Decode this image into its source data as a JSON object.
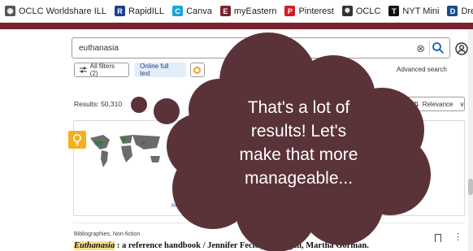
{
  "bookmarks": [
    {
      "label": "OCLC Worldshare ILL",
      "icon": "globe-icon",
      "color": "#555555",
      "glyph": "◉"
    },
    {
      "label": "RapidILL",
      "icon": "rapidill-icon",
      "color": "#1c3f94",
      "glyph": "R"
    },
    {
      "label": "Canva",
      "icon": "canva-icon",
      "color": "#1aa3d9",
      "glyph": "C"
    },
    {
      "label": "myEastern",
      "icon": "eastern-icon",
      "color": "#7a2230",
      "glyph": "E"
    },
    {
      "label": "Pinterest",
      "icon": "pinterest-icon",
      "color": "#cb1f27",
      "glyph": "P"
    },
    {
      "label": "OCLC",
      "icon": "oclc-icon",
      "color": "#333333",
      "glyph": "✸"
    },
    {
      "label": "NYT Mini",
      "icon": "nyt-icon",
      "color": "#111111",
      "glyph": "T"
    },
    {
      "label": "Drexel Connect",
      "icon": "drexel-icon",
      "color": "#1a4a8a",
      "glyph": "D"
    }
  ],
  "search": {
    "value": "euthanasia"
  },
  "filters": {
    "all": "All filters (2)",
    "full_text": "Online full text"
  },
  "advanced": "Advanced search",
  "results": "Results: 50,310",
  "sort": "Relevance",
  "card": {
    "label1": "REL",
    "label2": "Re"
  },
  "record": {
    "category": "Bibliographies, Non-fiction",
    "title_highlight": "Euthanasia",
    "title_rest": " : a reference handbook / Jennifer Fecio McDougall, Martha Gorman."
  },
  "callout": {
    "line1": "That's a lot of",
    "line2": "results! Let's",
    "line3": "make that more",
    "line4": "manageable..."
  },
  "colors": {
    "brand_maroon": "#7a2230",
    "cloud": "#5a3338",
    "highlight": "#f7df8c",
    "accent_blue": "#1a3f8a"
  }
}
